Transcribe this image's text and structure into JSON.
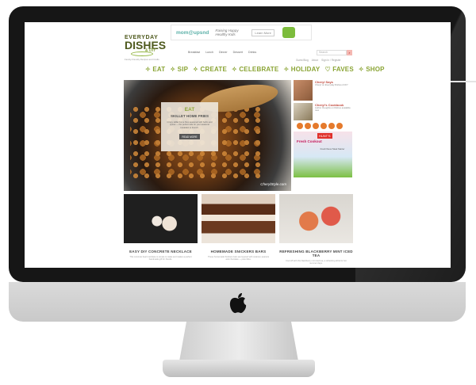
{
  "ad_top": {
    "brand": "mom@upsnd",
    "slogan": "Raising Happy Healthy Kids",
    "cta": "Learn More"
  },
  "logo": {
    "line1": "EVERYDAY",
    "line2": "DISHES",
    "line3": "& DIY",
    "tagline": "Family-Friendly Recipes and Crafts"
  },
  "topnav": [
    "Breakfast",
    "Lunch",
    "Dinner",
    "Dessert",
    "Drinks"
  ],
  "search": {
    "placeholder": "Search"
  },
  "subnav": [
    "Guest Blog",
    "About",
    "Sign In / Register"
  ],
  "mainnav": [
    "✧ EAT",
    "✧ SIP",
    "✧ CREATE",
    "✧ CELEBRATE",
    "✧ HOLIDAY",
    "♡ FAVES",
    "✧ SHOP"
  ],
  "hero": {
    "category": "EAT",
    "title": "SKILLET HOME FRIES",
    "blurb": "Crispy skillet home fries seasoned with herbs and spices — the perfect side for your weekend breakfast or brunch.",
    "button": "READ MORE",
    "credit": "CherylStyle.com"
  },
  "sidebar": {
    "items": [
      {
        "title": "Cheryl Says",
        "text": "Cheryl on Everyday Dishes & DIY"
      },
      {
        "title": "Cheryl's Cookbook",
        "text": "Author thoughts on Dishes available now"
      }
    ],
    "ad": {
      "badge": "HUNT'S",
      "headline": "Fresh Cookout",
      "sub": "Fresh flavor Meal Starter"
    }
  },
  "cards": [
    {
      "caption": "EASY DIY CONCRETE NECKLACE",
      "desc": "This concrete heart necklace is simple to make and makes a perfect handmade gift for friends."
    },
    {
      "caption": "HOMEMADE SNICKERS BARS",
      "desc": "These homemade Snickers bars are layered with caramel, peanuts and chocolate — pure bliss."
    },
    {
      "caption": "REFRESHING BLACKBERRY MINT ICED TEA",
      "desc": "Cool off with this blackberry mint iced tea, a refreshing drink for hot summer days."
    }
  ],
  "colors": {
    "nav_green": "#8aa434",
    "logo_green": "#4f5a1e",
    "accent_red": "#c0463a",
    "social_orange": "#e57a2c",
    "bezel": "#161616"
  },
  "icons": [
    "apple-logo-icon",
    "search-icon",
    "social-icons"
  ]
}
